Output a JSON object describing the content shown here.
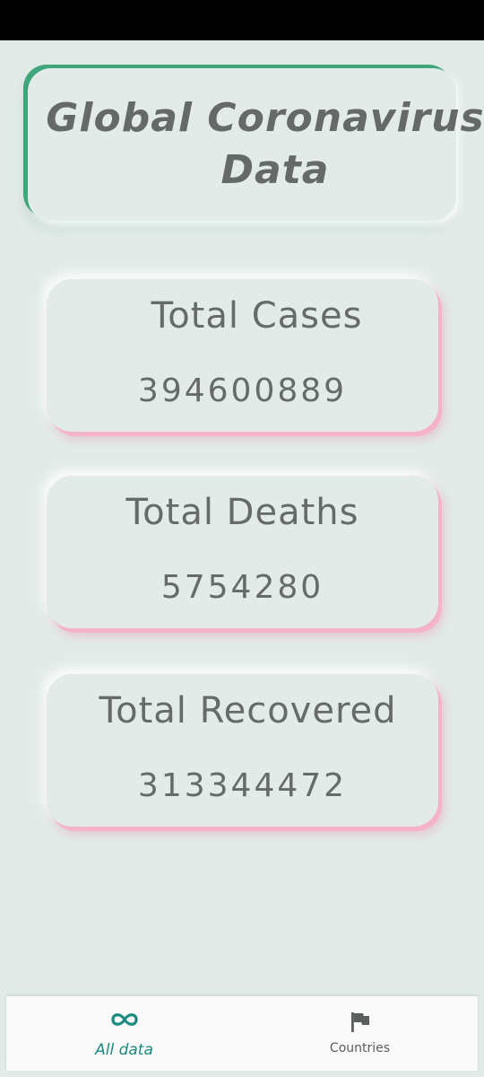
{
  "header": {
    "title_line1": "Global Coronavirus",
    "title_line2": "Data"
  },
  "stats": {
    "cases": {
      "label": "Total Cases",
      "value": "394600889"
    },
    "deaths": {
      "label": "Total Deaths",
      "value": "5754280"
    },
    "recovered": {
      "label": "Total Recovered",
      "value": "313344472"
    }
  },
  "bottom_nav": {
    "items": [
      {
        "label": "All data",
        "icon": "infinity-icon",
        "active": true
      },
      {
        "label": "Countries",
        "icon": "flag-icon",
        "active": false
      }
    ]
  },
  "colors": {
    "background": "#e2ebe8",
    "title_accent": "#3fa57a",
    "card_accent": "#f5b3c9",
    "text": "#666a68",
    "nav_active": "#1b8a81",
    "nav_inactive": "#5a5e5c"
  }
}
